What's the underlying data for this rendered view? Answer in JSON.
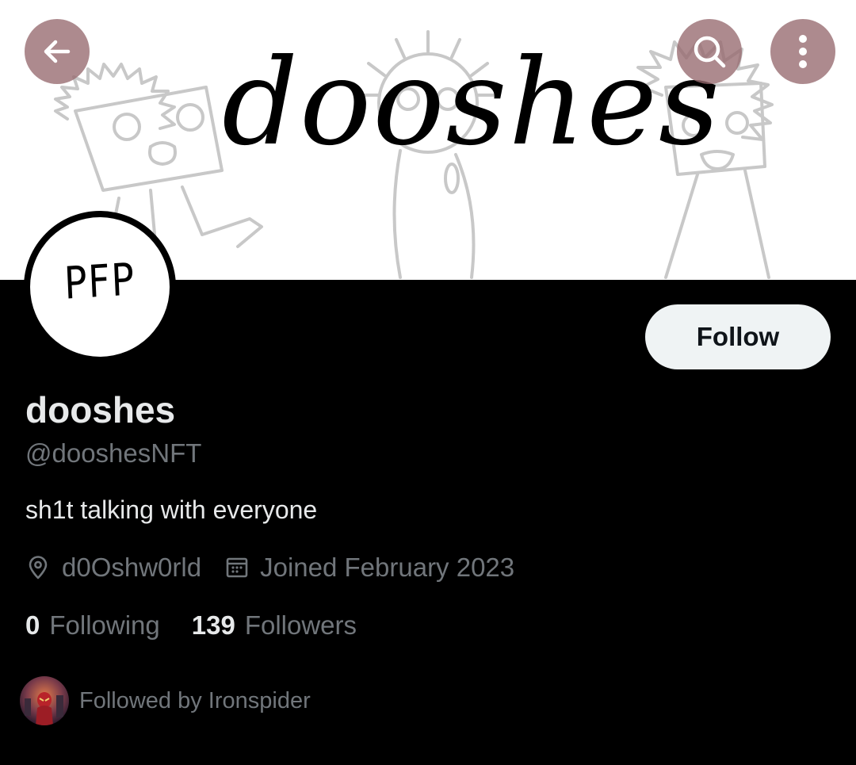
{
  "header": {
    "banner_title": "dooshes",
    "back_icon": "arrow-left-icon",
    "search_icon": "search-icon",
    "more_icon": "more-vertical-icon"
  },
  "profile": {
    "avatar_text": "PFP",
    "display_name": "dooshes",
    "handle": "@dooshesNFT",
    "bio": "sh1t talking with everyone",
    "location": "d0Oshw0rld",
    "joined": "Joined February 2023",
    "follow_label": "Follow"
  },
  "stats": {
    "following_count": "0",
    "following_label": "Following",
    "followers_count": "139",
    "followers_label": "Followers"
  },
  "followed_by": {
    "text": "Followed by Ironspider"
  },
  "colors": {
    "background": "#000000",
    "primary_text": "#e7e9ea",
    "secondary_text": "#71767b",
    "follow_button_bg": "#eff3f4",
    "overlay_button": "#96696e"
  }
}
